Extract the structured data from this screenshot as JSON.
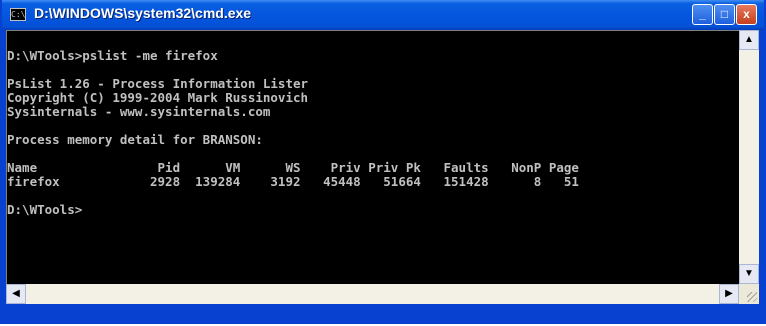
{
  "window": {
    "title": "D:\\WINDOWS\\system32\\cmd.exe",
    "icon": "C:\\",
    "controls": {
      "minimize": "_",
      "maximize": "□",
      "close": "x"
    }
  },
  "console": {
    "lines": [
      "",
      "D:\\WTools>pslist -me firefox",
      "",
      "PsList 1.26 - Process Information Lister",
      "Copyright (C) 1999-2004 Mark Russinovich",
      "Sysinternals - www.sysinternals.com",
      "",
      "Process memory detail for BRANSON:",
      "",
      "Name                Pid      VM      WS    Priv Priv Pk   Faults   NonP Page",
      "firefox            2928  139284    3192   45448   51664   151428      8   51",
      "",
      "D:\\WTools>",
      "",
      "",
      ""
    ]
  },
  "scrollbars": {
    "up": "▲",
    "down": "▼",
    "left": "◀",
    "right": "▶"
  }
}
